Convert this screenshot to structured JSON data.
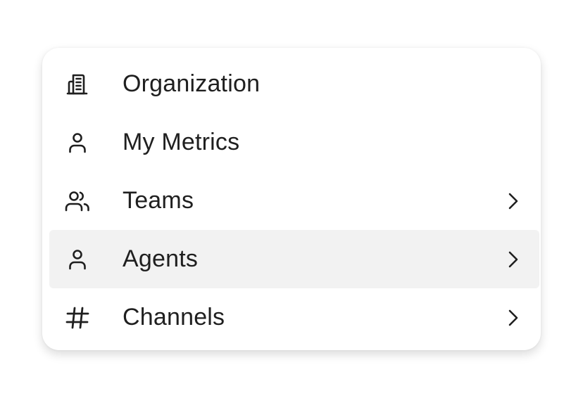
{
  "menu": {
    "items": [
      {
        "label": "Organization",
        "icon": "building-icon",
        "has_submenu": false,
        "active": false
      },
      {
        "label": "My Metrics",
        "icon": "user-icon",
        "has_submenu": false,
        "active": false
      },
      {
        "label": "Teams",
        "icon": "users-icon",
        "has_submenu": true,
        "active": false
      },
      {
        "label": "Agents",
        "icon": "user-icon",
        "has_submenu": true,
        "active": true
      },
      {
        "label": "Channels",
        "icon": "hash-icon",
        "has_submenu": true,
        "active": false
      }
    ]
  },
  "colors": {
    "text": "#1f1f1f",
    "active_background": "#f2f2f2",
    "panel_background": "#ffffff"
  }
}
